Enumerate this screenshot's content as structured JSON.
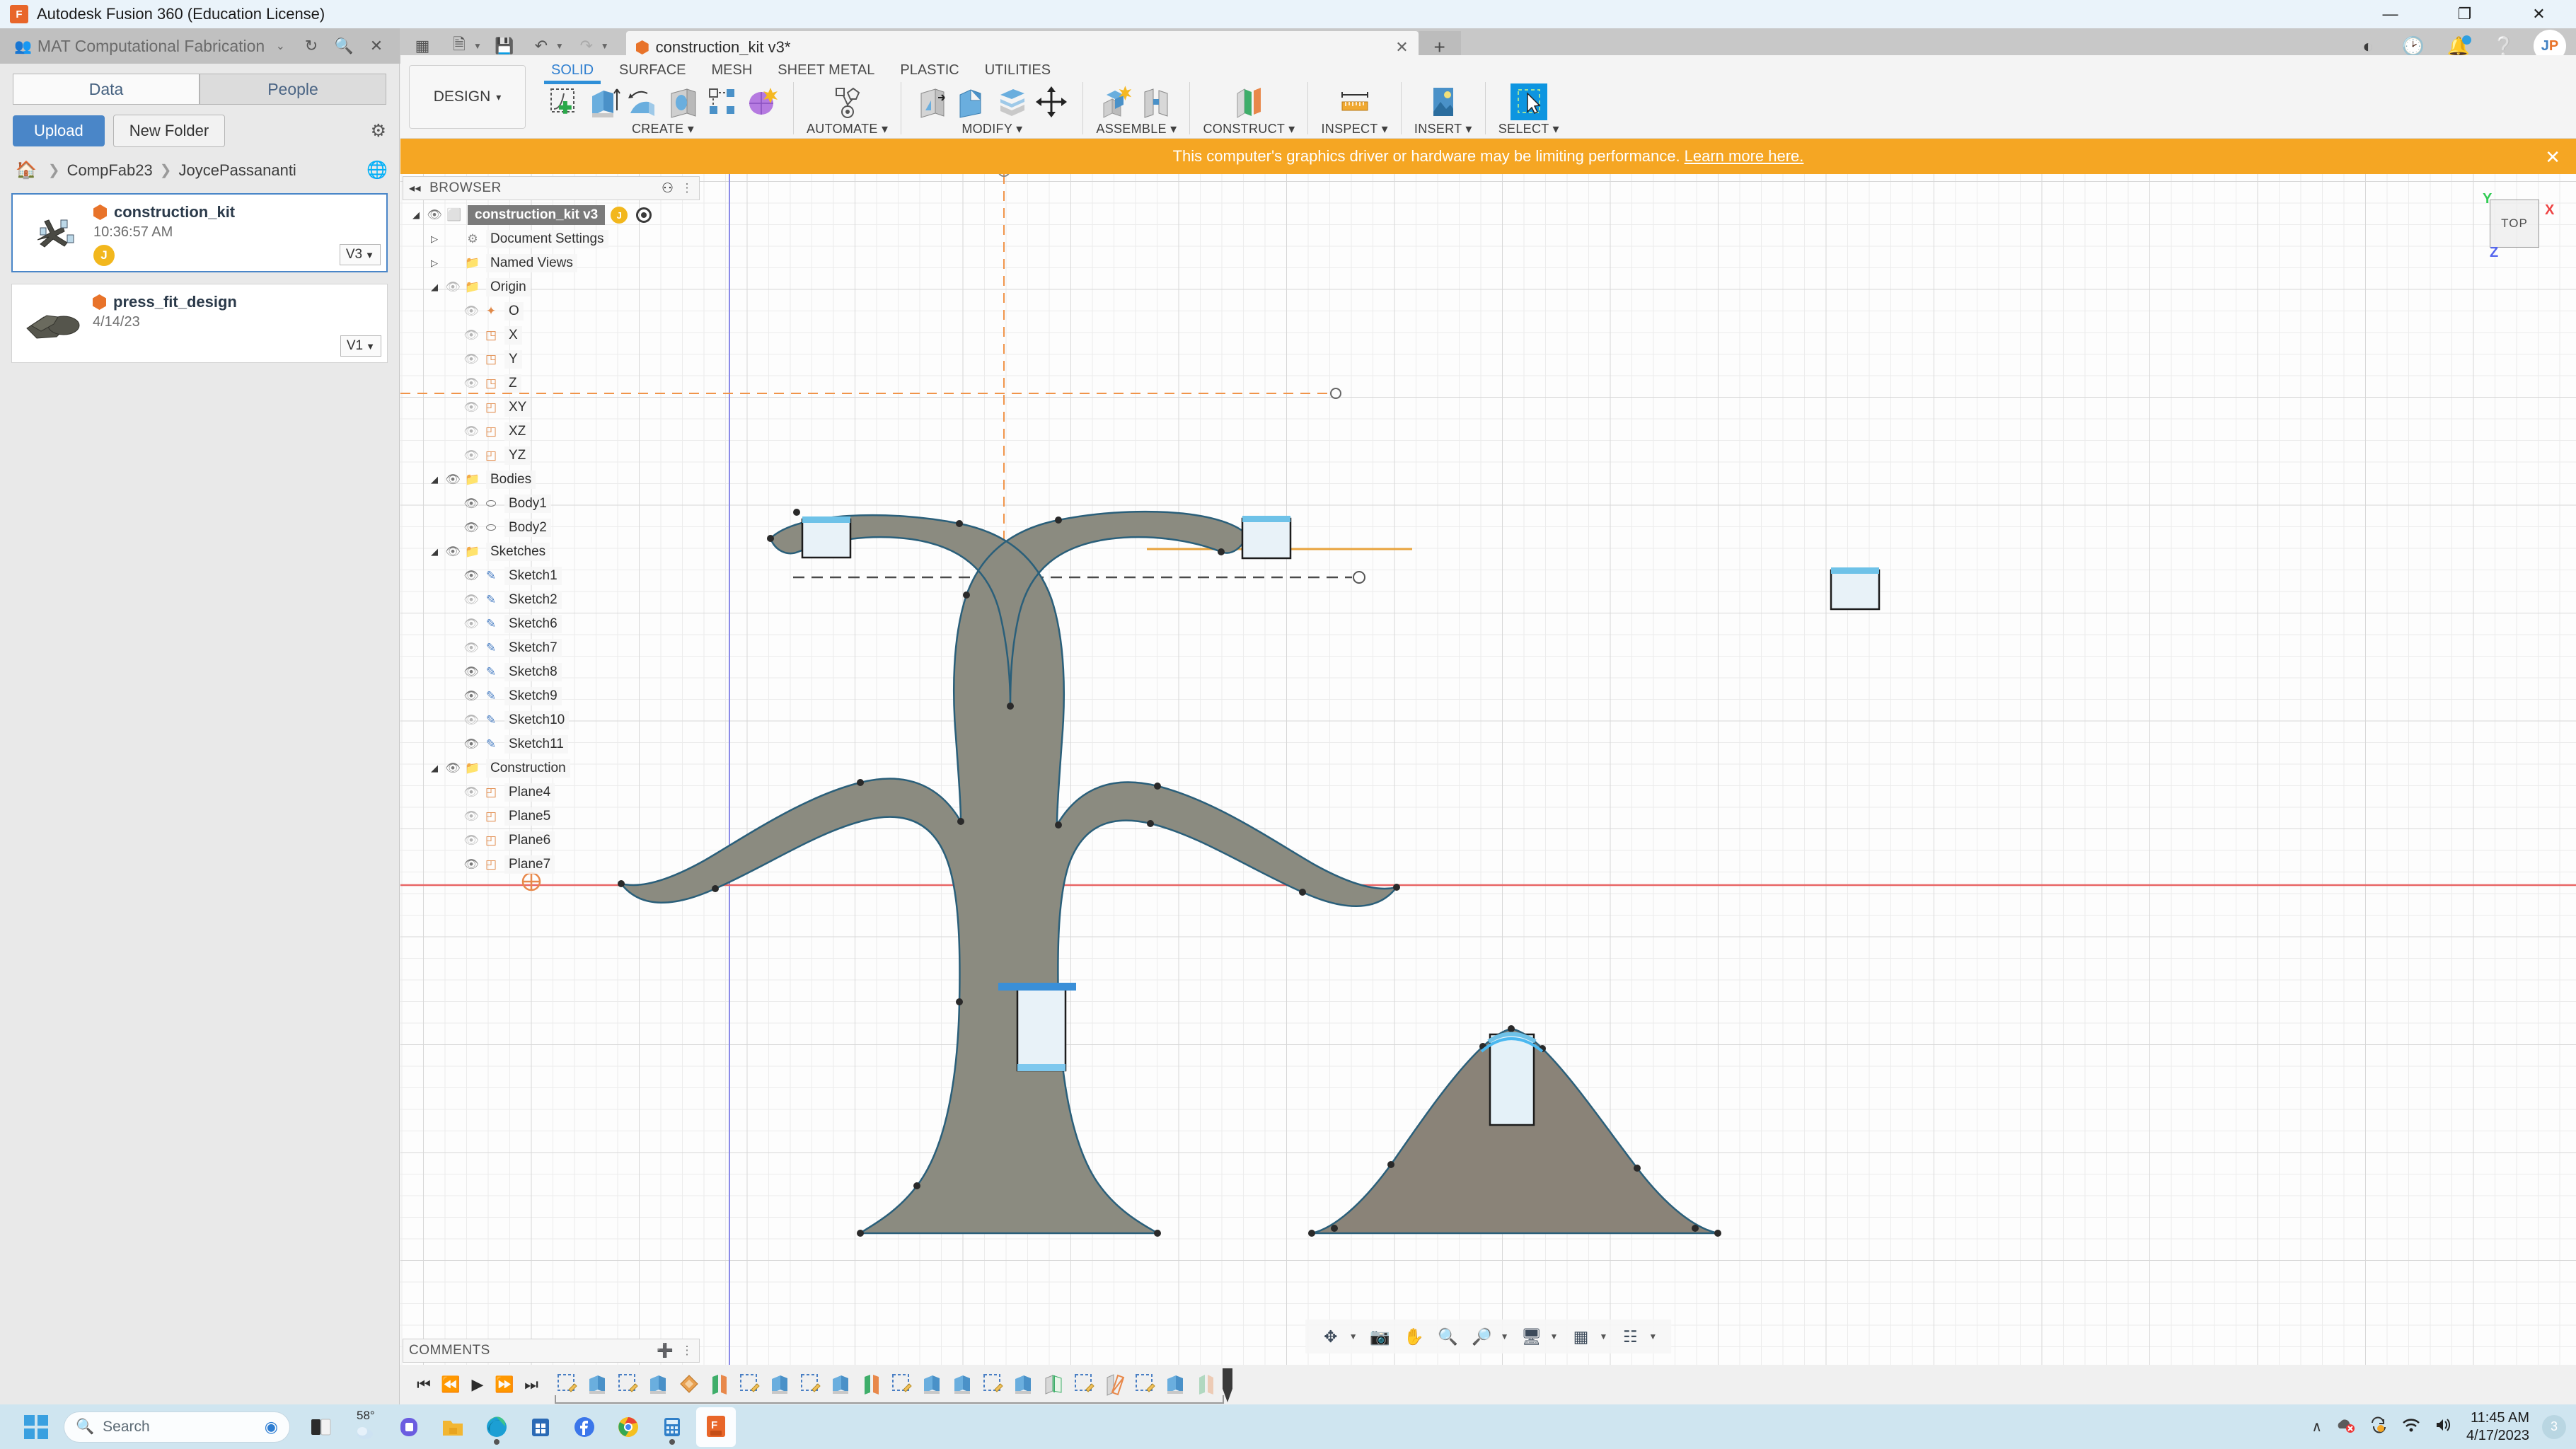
{
  "os": {
    "app_title": "Autodesk Fusion 360 (Education License)",
    "app_icon": "fusion-logo-icon",
    "minimize": "—",
    "maximize": "❐",
    "close": "✕"
  },
  "topbar": {
    "team_name": "MAT Computational Fabrication",
    "team_caret": "⌄",
    "refresh_icon": "refresh-icon",
    "search_icon": "search-icon",
    "close_panel_icon": "close-icon",
    "grid_icon": "grid-apps-icon",
    "new_icon": "new-document-icon",
    "save_icon": "save-icon",
    "undo_icon": "undo-icon",
    "redo_icon": "redo-icon",
    "doc_tab_title": "construction_kit v3*",
    "tab_close": "✕",
    "tab_add": "+",
    "extensions_icon": "extensions-icon",
    "recent_icon": "recent-clock-icon",
    "notifications_icon": "notification-bell-icon",
    "help_icon": "help-icon",
    "avatar_initials": [
      "J",
      "P"
    ]
  },
  "data_panel": {
    "tabs": [
      {
        "label": "Data",
        "active": true
      },
      {
        "label": "People",
        "active": false
      }
    ],
    "upload_label": "Upload",
    "new_folder_label": "New Folder",
    "settings_icon": "gear-icon",
    "breadcrumb": {
      "home_icon": "home-icon",
      "items": [
        "CompFab23",
        "JoycePassananti"
      ],
      "separator": "❯",
      "globe_icon": "globe-visibility-icon"
    },
    "files": [
      {
        "name": "construction_kit",
        "date": "10:36:57 AM",
        "version": "V3",
        "user_initial": "J",
        "selected": true
      },
      {
        "name": "press_fit_design",
        "date": "4/14/23",
        "version": "V1",
        "user_initial": "",
        "selected": false
      }
    ],
    "version_caret": "▼"
  },
  "ribbon": {
    "workspace_label": "DESIGN",
    "workspace_caret": "▾",
    "tabs": [
      {
        "label": "SOLID",
        "active": true
      },
      {
        "label": "SURFACE",
        "active": false
      },
      {
        "label": "MESH",
        "active": false
      },
      {
        "label": "SHEET METAL",
        "active": false
      },
      {
        "label": "PLASTIC",
        "active": false
      },
      {
        "label": "UTILITIES",
        "active": false
      }
    ],
    "groups": [
      {
        "label": "CREATE ▾",
        "icons": [
          "create-sketch-icon",
          "extrude-icon",
          "revolve-icon",
          "hole-icon",
          "pattern-icon",
          "form-icon"
        ]
      },
      {
        "label": "AUTOMATE ▾",
        "icons": [
          "automate-generative-icon"
        ]
      },
      {
        "label": "MODIFY ▾",
        "icons": [
          "press-pull-icon",
          "fillet-icon",
          "shell-icon",
          "draft-icon",
          "combine-icon",
          "move-copy-icon"
        ]
      },
      {
        "label": "ASSEMBLE ▾",
        "icons": [
          "new-component-icon",
          "joint-icon"
        ]
      },
      {
        "label": "CONSTRUCT ▾",
        "icons": [
          "offset-plane-icon"
        ]
      },
      {
        "label": "INSPECT ▾",
        "icons": [
          "measure-icon"
        ]
      },
      {
        "label": "INSERT ▾",
        "icons": [
          "insert-image-icon"
        ]
      },
      {
        "label": "SELECT ▾",
        "icons": [
          "select-window-icon"
        ]
      }
    ]
  },
  "banner": {
    "message": "This computer's graphics driver or hardware may be limiting performance.",
    "link_text": "Learn more here.",
    "close": "✕",
    "color": "#f5a623"
  },
  "browser": {
    "title": "BROWSER",
    "collapse_icon": "collapse-left-icon",
    "minus_icon": "minus-circle-icon",
    "grip_icon": "resize-grip-icon",
    "tree": [
      {
        "label": "construction_kit v3",
        "indent": 0,
        "arrow": "◢",
        "eye": "on",
        "icon": "component-icon",
        "root": true,
        "badge_clock": "J",
        "badge_dot": true
      },
      {
        "label": "Document Settings",
        "indent": 1,
        "arrow": "▷",
        "eye": "none",
        "icon": "gear-icon"
      },
      {
        "label": "Named Views",
        "indent": 1,
        "arrow": "▷",
        "eye": "none",
        "icon": "folder-icon"
      },
      {
        "label": "Origin",
        "indent": 1,
        "arrow": "◢",
        "eye": "off",
        "icon": "folder-icon"
      },
      {
        "label": "O",
        "indent": 2,
        "arrow": "",
        "eye": "off",
        "icon": "origin-point-icon"
      },
      {
        "label": "X",
        "indent": 2,
        "arrow": "",
        "eye": "off",
        "icon": "axis-icon"
      },
      {
        "label": "Y",
        "indent": 2,
        "arrow": "",
        "eye": "off",
        "icon": "axis-icon"
      },
      {
        "label": "Z",
        "indent": 2,
        "arrow": "",
        "eye": "off",
        "icon": "axis-icon"
      },
      {
        "label": "XY",
        "indent": 2,
        "arrow": "",
        "eye": "off",
        "icon": "plane-icon"
      },
      {
        "label": "XZ",
        "indent": 2,
        "arrow": "",
        "eye": "off",
        "icon": "plane-icon"
      },
      {
        "label": "YZ",
        "indent": 2,
        "arrow": "",
        "eye": "off",
        "icon": "plane-icon"
      },
      {
        "label": "Bodies",
        "indent": 1,
        "arrow": "◢",
        "eye": "on",
        "icon": "folder-icon"
      },
      {
        "label": "Body1",
        "indent": 2,
        "arrow": "",
        "eye": "on",
        "icon": "body-icon"
      },
      {
        "label": "Body2",
        "indent": 2,
        "arrow": "",
        "eye": "on",
        "icon": "body-icon"
      },
      {
        "label": "Sketches",
        "indent": 1,
        "arrow": "◢",
        "eye": "on",
        "icon": "folder-icon"
      },
      {
        "label": "Sketch1",
        "indent": 2,
        "arrow": "",
        "eye": "on",
        "icon": "sketch-icon"
      },
      {
        "label": "Sketch2",
        "indent": 2,
        "arrow": "",
        "eye": "off",
        "icon": "sketch-icon"
      },
      {
        "label": "Sketch6",
        "indent": 2,
        "arrow": "",
        "eye": "off",
        "icon": "sketch-icon"
      },
      {
        "label": "Sketch7",
        "indent": 2,
        "arrow": "",
        "eye": "off",
        "icon": "sketch-icon"
      },
      {
        "label": "Sketch8",
        "indent": 2,
        "arrow": "",
        "eye": "on",
        "icon": "sketch-icon"
      },
      {
        "label": "Sketch9",
        "indent": 2,
        "arrow": "",
        "eye": "on",
        "icon": "sketch-icon"
      },
      {
        "label": "Sketch10",
        "indent": 2,
        "arrow": "",
        "eye": "off",
        "icon": "sketch-icon"
      },
      {
        "label": "Sketch11",
        "indent": 2,
        "arrow": "",
        "eye": "on",
        "icon": "sketch-icon"
      },
      {
        "label": "Construction",
        "indent": 1,
        "arrow": "◢",
        "eye": "on",
        "icon": "folder-icon"
      },
      {
        "label": "Plane4",
        "indent": 2,
        "arrow": "",
        "eye": "off",
        "icon": "plane-icon"
      },
      {
        "label": "Plane5",
        "indent": 2,
        "arrow": "",
        "eye": "off",
        "icon": "plane-icon"
      },
      {
        "label": "Plane6",
        "indent": 2,
        "arrow": "",
        "eye": "off",
        "icon": "plane-icon"
      },
      {
        "label": "Plane7",
        "indent": 2,
        "arrow": "",
        "eye": "on",
        "icon": "plane-icon"
      }
    ]
  },
  "comments": {
    "title": "COMMENTS",
    "add_icon": "plus-circle-icon",
    "grip_icon": "resize-grip-icon"
  },
  "viewcube": {
    "face_label": "TOP",
    "axis_x": "X",
    "axis_y": "Y",
    "axis_z": "Z",
    "color_x": "#ee4444",
    "color_y": "#33cc55",
    "color_z": "#5566ee"
  },
  "navbar": {
    "items": [
      {
        "icon": "orbit-icon",
        "caret": "▾"
      },
      {
        "icon": "look-at-icon",
        "caret": ""
      },
      {
        "icon": "pan-hand-icon",
        "caret": ""
      },
      {
        "icon": "zoom-icon",
        "caret": ""
      },
      {
        "icon": "zoom-window-icon",
        "caret": "▾"
      },
      {
        "icon": "display-settings-icon",
        "caret": "▾"
      },
      {
        "icon": "grid-snap-icon",
        "caret": "▾"
      },
      {
        "icon": "viewports-icon",
        "caret": "▾"
      }
    ]
  },
  "timeline": {
    "controls": [
      "skip-start-icon",
      "step-back-icon",
      "play-icon",
      "step-forward-icon",
      "skip-end-icon"
    ],
    "features": [
      "sketch-icon",
      "extrude-icon",
      "sketch-icon",
      "extrude-icon",
      "plane-icon",
      "plane-construct-icon",
      "sketch-icon",
      "extrude-icon",
      "sketch-icon",
      "extrude-icon",
      "plane-construct-icon",
      "sketch-icon",
      "extrude-icon",
      "extrude-icon",
      "sketch-icon",
      "extrude-icon",
      "split-icon",
      "sketch-icon",
      "plane-angle-icon",
      "sketch-icon",
      "extrude-icon",
      "split-ghost-icon"
    ],
    "settings_icon": "gear-icon"
  },
  "canvas": {
    "shape_fill": "#8b8b80",
    "shape_fill_2": "#8a8378",
    "edge_color": "#2a5f7a",
    "origin_axis_x_color": "#f08a4a",
    "origin_axis_y_color": "#7a7ae0",
    "ground_line_color": "#e86666",
    "construction_line_color": "#e8a33d"
  },
  "taskbar": {
    "start_icon": "windows-start-icon",
    "search_placeholder": "Search",
    "search_icon": "search-icon",
    "copilot_icon": "copilot-icon",
    "weather_temp": "58°",
    "apps": [
      {
        "icon": "task-view-icon",
        "running": false
      },
      {
        "icon": "weather-icon",
        "running": false
      },
      {
        "icon": "teams-icon",
        "running": false
      },
      {
        "icon": "file-explorer-icon",
        "running": false
      },
      {
        "icon": "edge-icon",
        "running": true
      },
      {
        "icon": "microsoft-store-icon",
        "running": false
      },
      {
        "icon": "facebook-icon",
        "running": false
      },
      {
        "icon": "chrome-icon",
        "running": false
      },
      {
        "icon": "calculator-icon",
        "running": true
      },
      {
        "icon": "fusion360-icon",
        "running": true,
        "active": true
      }
    ],
    "tray": {
      "chevron": "∧",
      "onedrive_icon": "onedrive-error-icon",
      "sync_icon": "sync-pending-icon",
      "wifi_icon": "wifi-icon",
      "volume_icon": "volume-icon",
      "time": "11:45 AM",
      "date": "4/17/2023",
      "notification_count": "3"
    }
  }
}
